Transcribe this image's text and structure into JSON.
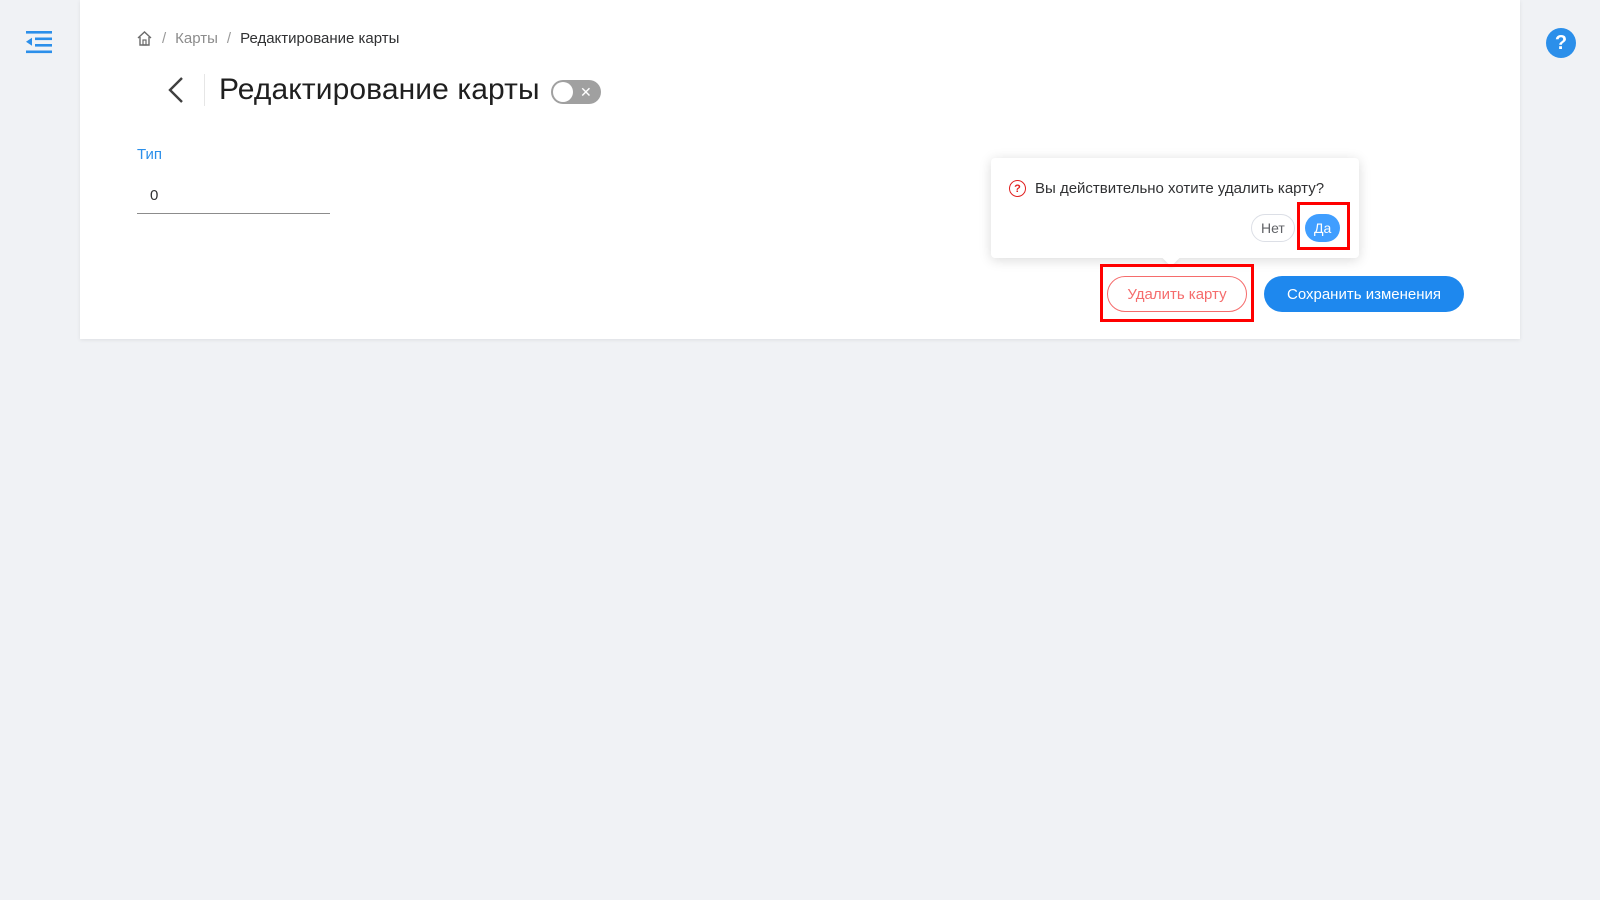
{
  "breadcrumb": {
    "home_icon": "home-icon",
    "items": [
      "Карты",
      "Редактирование карты"
    ],
    "separator": "/"
  },
  "page": {
    "title": "Редактирование карты",
    "back_icon": "chevron-left-icon",
    "toggle": {
      "state": "off",
      "off_glyph": "✕"
    }
  },
  "form": {
    "type_label": "Тип",
    "type_value": "0"
  },
  "popconfirm": {
    "icon": "question-circle-icon",
    "message": "Вы действительно хотите удалить карту?",
    "no_label": "Нет",
    "yes_label": "Да"
  },
  "actions": {
    "delete_label": "Удалить карту",
    "save_label": "Сохранить изменения"
  },
  "header": {
    "menu_icon": "menu-fold-icon",
    "help_glyph": "?"
  },
  "colors": {
    "accent": "#2b8fea",
    "danger": "#f56c6c",
    "highlight": "#ff0000"
  }
}
